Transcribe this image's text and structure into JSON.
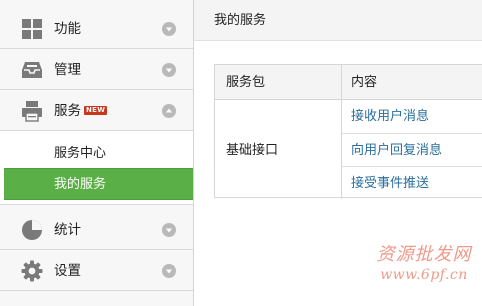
{
  "sidebar": {
    "items": [
      {
        "label": "功能",
        "icon": "grid-icon"
      },
      {
        "label": "管理",
        "icon": "inbox-icon"
      },
      {
        "label": "服务",
        "icon": "printer-icon",
        "badge": "NEW",
        "expanded": true,
        "children": [
          {
            "label": "服务中心",
            "active": false
          },
          {
            "label": "我的服务",
            "active": true
          }
        ]
      },
      {
        "label": "统计",
        "icon": "pie-chart-icon"
      },
      {
        "label": "设置",
        "icon": "gear-icon"
      }
    ]
  },
  "main": {
    "title": "我的服务",
    "table": {
      "headers": [
        "服务包",
        "内容"
      ],
      "package": "基础接口",
      "contents": [
        "接收用户消息",
        "向用户回复消息",
        "接受事件推送"
      ]
    }
  },
  "watermark": {
    "top": "资源批发网",
    "bottom": "www.6pf.cn"
  },
  "colors": {
    "active_bg": "#5ab046",
    "link": "#2a6e9e",
    "badge": "#c9361e"
  }
}
